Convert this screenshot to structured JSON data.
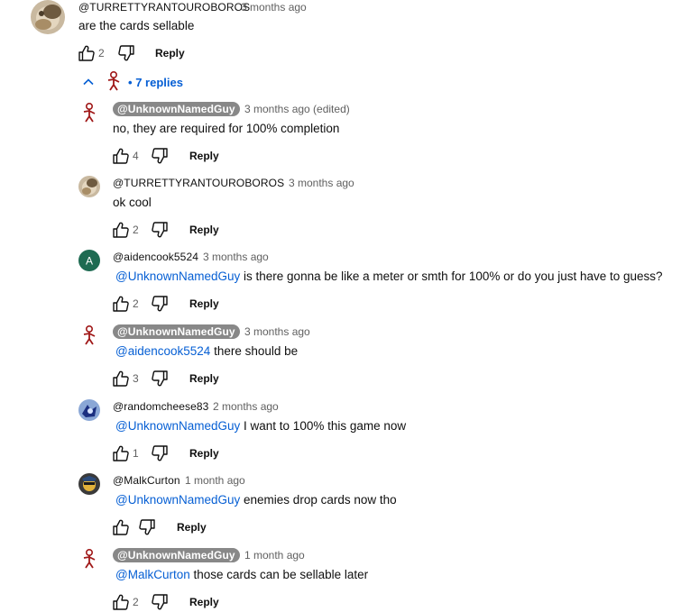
{
  "top_comment": {
    "author": "@TURRETTYRANTOUROBOROS",
    "time": "3 months ago",
    "text": "are the cards sellable",
    "likes": "2",
    "reply_label": "Reply"
  },
  "replies_toggle": {
    "label": "7 replies",
    "bullet": "•"
  },
  "replies": [
    {
      "author": "@UnknownNamedGuy",
      "creator": true,
      "time": "3 months ago (edited)",
      "mention": "",
      "text": "no, they are required for 100% completion",
      "likes": "4",
      "reply_label": "Reply",
      "avatar": "stickman"
    },
    {
      "author": "@TURRETTYRANTOUROBOROS",
      "creator": false,
      "time": "3 months ago",
      "mention": "",
      "text": "ok cool",
      "likes": "2",
      "reply_label": "Reply",
      "avatar": "photo"
    },
    {
      "author": "@aidencook5524",
      "creator": false,
      "time": "3 months ago",
      "mention": "@UnknownNamedGuy",
      "text": "is there gonna be like a meter or smth for 100% or do you just have to guess?",
      "likes": "2",
      "reply_label": "Reply",
      "avatar": "letter",
      "avatar_letter": "A"
    },
    {
      "author": "@UnknownNamedGuy",
      "creator": true,
      "time": "3 months ago",
      "mention": "@aidencook5524",
      "text": "there should be",
      "likes": "3",
      "reply_label": "Reply",
      "avatar": "stickman"
    },
    {
      "author": "@randomcheese83",
      "creator": false,
      "time": "2 months ago",
      "mention": "@UnknownNamedGuy",
      "text": "I want to 100% this game now",
      "likes": "1",
      "reply_label": "Reply",
      "avatar": "blue"
    },
    {
      "author": "@MalkCurton",
      "creator": false,
      "time": "1 month ago",
      "mention": "@UnknownNamedGuy",
      "text": "enemies drop cards now tho",
      "likes": "",
      "reply_label": "Reply",
      "avatar": "dark"
    },
    {
      "author": "@UnknownNamedGuy",
      "creator": true,
      "time": "1 month ago",
      "mention": "@MalkCurton",
      "text": "those cards can be sellable later",
      "likes": "2",
      "reply_label": "Reply",
      "avatar": "stickman"
    }
  ],
  "colors": {
    "mention": "#065fd4",
    "creator_chip": "#888888",
    "avatar_letter_bg": "#1e6b52"
  },
  "icons": [
    "thumbs-up-icon",
    "thumbs-down-icon",
    "chevron-up-icon"
  ]
}
